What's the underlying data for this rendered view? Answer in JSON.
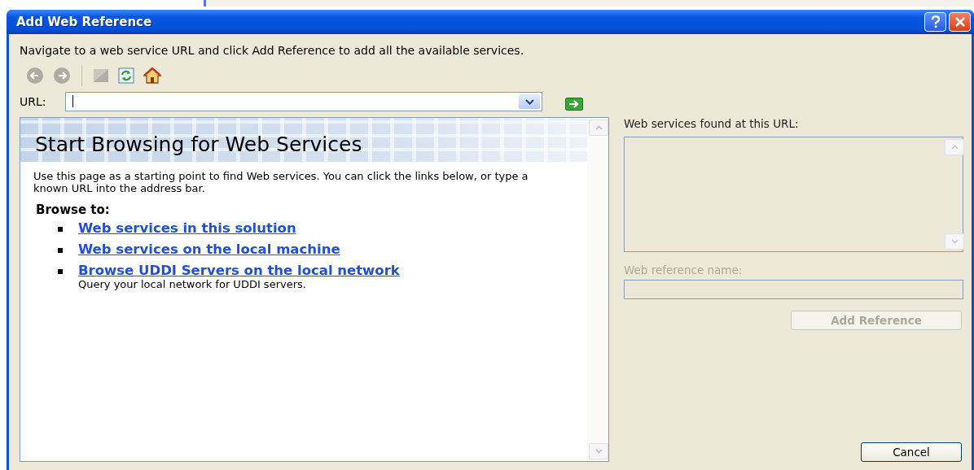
{
  "window": {
    "title": "Add Web Reference"
  },
  "instructions": "Navigate to a web service URL and click Add Reference to add all the available services.",
  "toolbar": [
    {
      "kind": "back",
      "disabled": true
    },
    {
      "kind": "forward",
      "disabled": true
    },
    {
      "kind": "stop",
      "disabled": true
    },
    {
      "kind": "refresh",
      "disabled": false
    },
    {
      "kind": "home",
      "disabled": false
    }
  ],
  "url": {
    "label": "URL:"
  },
  "browser": {
    "heading": "Start Browsing for Web Services",
    "intro": "Use this page as a starting point to find Web services. You can click the links below, or type a known URL into the address bar.",
    "browse_label": "Browse to:",
    "links": [
      {
        "text": "Web services in this solution"
      },
      {
        "text": "Web services on the local machine"
      },
      {
        "text": "Browse UDDI Servers on the local network",
        "note": "Query your local network for UDDI servers."
      }
    ]
  },
  "services": {
    "label": "Web services found at this URL:"
  },
  "reference_name": {
    "label": "Web reference name:",
    "disabled": true
  },
  "buttons": [
    {
      "label": "Add Reference",
      "kind": "add",
      "disabled": true
    },
    {
      "label": "Cancel",
      "kind": "cancel",
      "disabled": false
    }
  ]
}
